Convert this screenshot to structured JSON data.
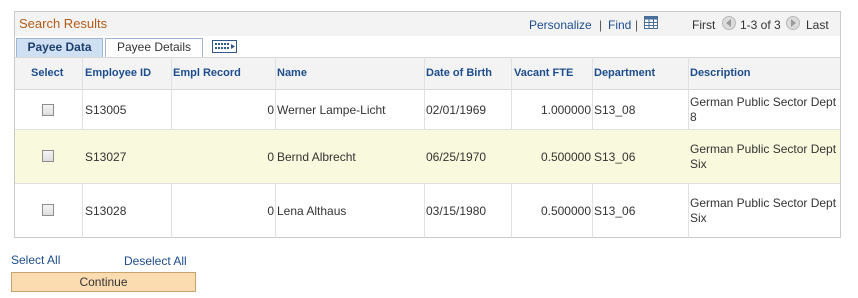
{
  "grid": {
    "title": "Search Results",
    "personalize": "Personalize",
    "find": "Find",
    "first": "First",
    "range": "1-3 of 3",
    "last": "Last"
  },
  "tabs": [
    {
      "label": "Payee Data"
    },
    {
      "label": "Payee Details"
    }
  ],
  "columns": [
    "Select",
    "Employee ID",
    "Empl Record",
    "Name",
    "Date of Birth",
    "Vacant FTE",
    "Department",
    "Description"
  ],
  "rows": [
    {
      "employee_id": "S13005",
      "empl_record": "0",
      "name": "Werner Lampe-Licht",
      "dob": "02/01/1969",
      "vacant_fte": "1.000000",
      "department": "S13_08",
      "desc_line1": "German Public Sector Dept",
      "desc_line2": "8"
    },
    {
      "employee_id": "S13027",
      "empl_record": "0",
      "name": "Bernd Albrecht",
      "dob": "06/25/1970",
      "vacant_fte": "0.500000",
      "department": "S13_06",
      "desc_line1": "German Public Sector Dept",
      "desc_line2": "Six"
    },
    {
      "employee_id": "S13028",
      "empl_record": "0",
      "name": "Lena Althaus",
      "dob": "03/15/1980",
      "vacant_fte": "0.500000",
      "department": "S13_06",
      "desc_line1": "German Public Sector Dept",
      "desc_line2": "Six"
    }
  ],
  "actions": {
    "select_all": "Select All",
    "deselect_all": "Deselect All",
    "continue": "Continue"
  },
  "colors": {
    "title": "#b55b17",
    "link": "#1d4d8c",
    "highlight_row": "#f9f9dd",
    "continue_button": "#fbdcb1"
  },
  "icons": [
    "grid-view-icon",
    "first-arrow-icon",
    "next-arrow-icon",
    "show-all-columns-icon"
  ]
}
